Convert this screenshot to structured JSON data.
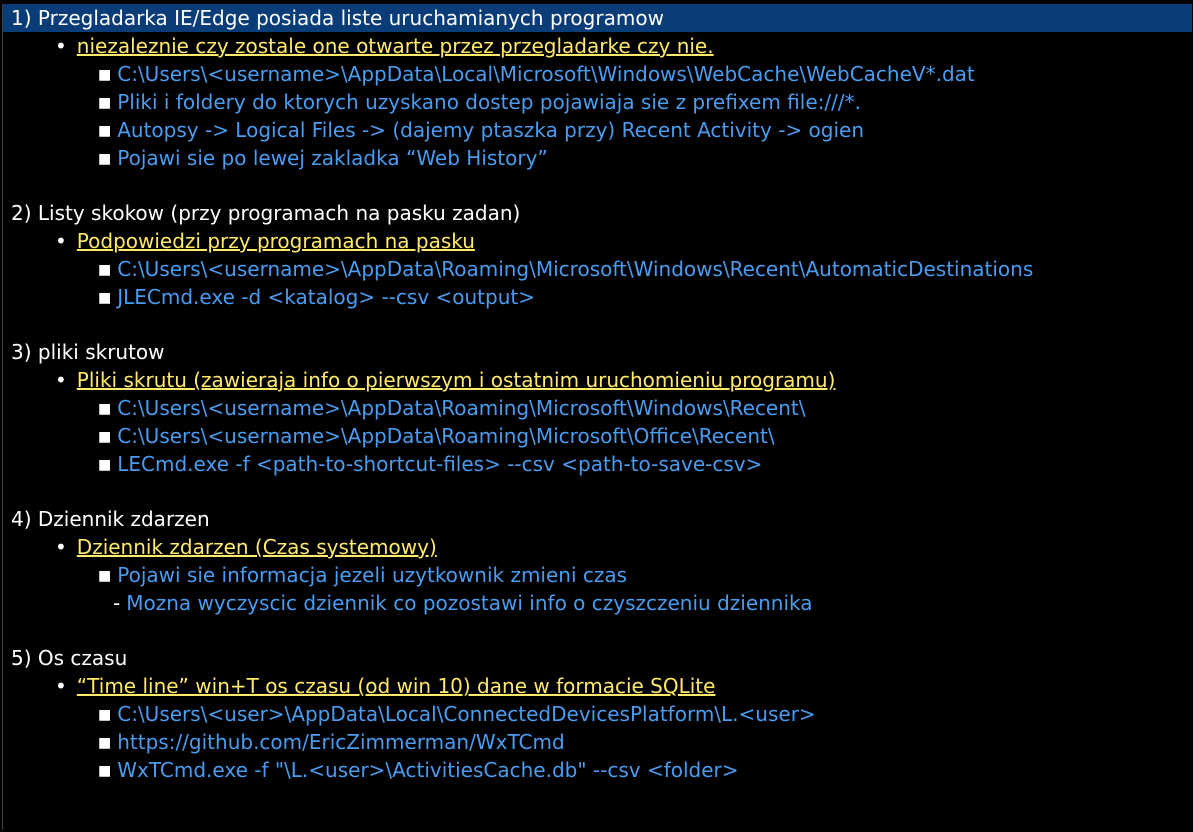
{
  "document": {
    "sections": [
      {
        "heading": "1) Przegladarka IE/Edge posiada liste uruchamianych programow",
        "bullet": "niezaleznie czy zostale one otwarte przez przegladarke czy nie.",
        "items": [
          "C:\\Users\\<username>\\AppData\\Local\\Microsoft\\Windows\\WebCache\\WebCacheV*.dat",
          "Pliki i foldery do ktorych uzyskano dostep pojawiaja sie z prefixem file:///*.",
          "Autopsy -> Logical Files -> (dajemy ptaszka przy) Recent Activity -> ogien",
          "Pojawi sie po lewej zakladka “Web History”"
        ]
      },
      {
        "heading": "2) Listy skokow (przy programach na pasku zadan)",
        "bullet": "Podpowiedzi przy programach na pasku",
        "items": [
          "C:\\Users\\<username>\\AppData\\Roaming\\Microsoft\\Windows\\Recent\\AutomaticDestinations",
          "JLECmd.exe -d <katalog> --csv <output>"
        ]
      },
      {
        "heading": "3) pliki skrutow",
        "bullet": "Pliki skrutu (zawieraja info o pierwszym i ostatnim uruchomieniu programu)",
        "items": [
          "C:\\Users\\<username>\\AppData\\Roaming\\Microsoft\\Windows\\Recent\\",
          "C:\\Users\\<username>\\AppData\\Roaming\\Microsoft\\Office\\Recent\\",
          "LECmd.exe -f <path-to-shortcut-files> --csv <path-to-save-csv>"
        ]
      },
      {
        "heading": "4) Dziennik zdarzen",
        "bullet": "Dziennik zdarzen (Czas systemowy)",
        "items": [
          "Pojawi sie informacja jezeli uzytkownik zmieni czas"
        ],
        "subitem": "Mozna wyczyscic dziennik co pozostawi info o czyszczeniu dziennika"
      },
      {
        "heading": "5) Os czasu",
        "bullet": "“Time line” win+T os czasu (od win 10) dane w formacie SQLite",
        "items": [
          "C:\\Users\\<user>\\AppData\\Local\\ConnectedDevicesPlatform\\L.<user>",
          "https://github.com/EricZimmerman/WxTCmd",
          "WxTCmd.exe -f \"\\L.<user>\\ActivitiesCache.db\" --csv <folder>"
        ]
      }
    ]
  },
  "colors": {
    "background": "#000000",
    "selection": "#0a3c78",
    "heading": "#ffffff",
    "bullet_text": "#ffe96a",
    "item_text": "#4a9cf0",
    "spellcheck": "#e11b1b"
  },
  "icons": {
    "bullet": "round-bullet-icon",
    "item": "square-bullet-icon",
    "subitem": "dash-bullet-icon"
  }
}
